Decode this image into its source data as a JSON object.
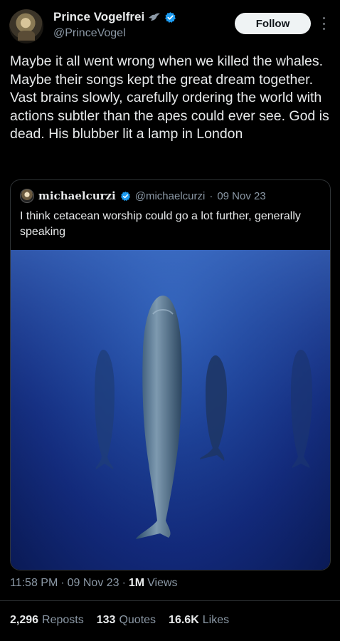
{
  "author": {
    "display_name": "Prince Vogelfrei",
    "handle": "@PrinceVogel",
    "follow_label": "Follow"
  },
  "tweet": {
    "text": "Maybe it all went wrong when we killed the whales. Maybe their songs kept the great dream together. Vast brains slowly, carefully ordering the world with actions subtler than the apes could ever see. God is dead. His blubber lit a lamp in London"
  },
  "quote": {
    "display_name": "michaelcurzi",
    "handle": "@michaelcurzi",
    "separator": "·",
    "date": "09 Nov 23",
    "text": "I think cetacean worship could go a lot further, generally speaking"
  },
  "meta": {
    "time": "11:58 PM",
    "dot1": "·",
    "date": "09 Nov 23",
    "dot2": "·",
    "views_count": "1M",
    "views_label": "Views"
  },
  "stats": {
    "reposts_count": "2,296",
    "reposts_label": "Reposts",
    "quotes_count": "133",
    "quotes_label": "Quotes",
    "likes_count": "16.6K",
    "likes_label": "Likes"
  },
  "colors": {
    "background": "#000000",
    "text": "#e7e9ea",
    "secondary": "#8b98a5",
    "verified": "#1d9bf0",
    "ocean": "#1c3f94"
  }
}
